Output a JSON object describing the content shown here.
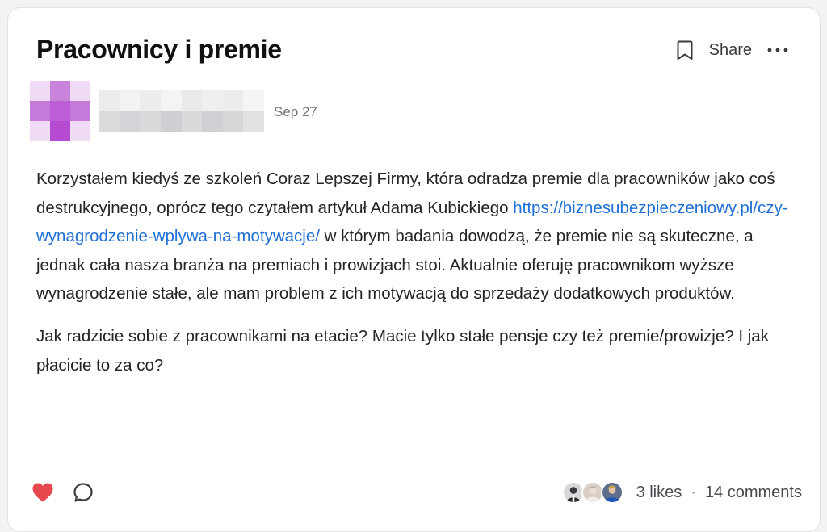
{
  "post": {
    "title": "Pracownicy i premie",
    "date": "Sep 27",
    "body": {
      "p1_before_link": "Korzystałem kiedyś ze szkoleń Coraz Lepszej Firmy, która odradza premie dla pracowników jako coś destrukcyjnego, oprócz tego czytałem artykuł Adama Kubickiego ",
      "link_text": "https://biznesubezpieczeniowy.pl/czy-wynagrodzenie-wplywa-na-motywacje/",
      "p1_after_link": " w którym badania dowodzą, że premie nie są skuteczne, a jednak cała nasza branża na premiach i prowizjach stoi. Aktualnie oferuję pracownikom wyższe wynagrodzenie stałe, ale mam problem z ich motywacją do sprzedaży dodatkowych produktów.",
      "p2": "Jak radzicie sobie z pracownikami na etacie? Macie tylko stałe pensje czy też premie/prowizje? I jak płacicie to za co?"
    }
  },
  "header_actions": {
    "share_label": "Share",
    "bookmark_icon": "bookmark-icon",
    "more_icon": "more-horizontal-icon"
  },
  "footer": {
    "likes_label": "3 likes",
    "separator": "·",
    "comments_label": "14 comments",
    "like_icon": "heart-icon",
    "comment_icon": "comment-bubble-icon",
    "liker_avatar_count": 3
  },
  "colors": {
    "link": "#1f6fd6",
    "heart": "#e5484d",
    "avatar_purple": "#b64ad1",
    "text": "#242428",
    "muted": "#75757c"
  }
}
